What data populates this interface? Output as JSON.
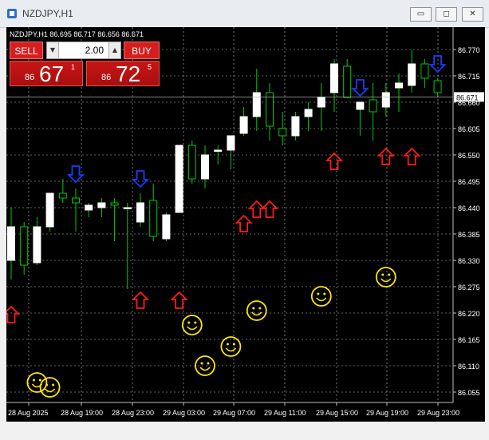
{
  "window": {
    "title": "NZDJPY,H1",
    "buttons": {
      "minimize": "▭",
      "restore": "◻",
      "close": "✕"
    }
  },
  "chart": {
    "symbol_line": "NZDJPY,H1 86.695 86.717 86.656 86.671",
    "current_price": "86.671",
    "price_labels": [
      "86.770",
      "86.715",
      "86.660",
      "86.605",
      "86.550",
      "86.495",
      "86.440",
      "86.385",
      "86.330",
      "86.275",
      "86.220",
      "86.165",
      "86.110",
      "86.055"
    ],
    "time_labels": [
      "28 Aug 2025",
      "28 Aug 19:00",
      "28 Aug 23:00",
      "29 Aug 03:00",
      "29 Aug 07:00",
      "29 Aug 11:00",
      "29 Aug 15:00",
      "29 Aug 19:00",
      "29 Aug 23:00"
    ],
    "colors": {
      "background": "#000000",
      "grid": "#c0c0c0",
      "wick": "#00cc00",
      "bull_body": "#ffffff",
      "sell_arrow": "#1a3cff",
      "buy_arrow": "#ff1a1a",
      "smiley": "#ffe600"
    },
    "candles": [
      {
        "o": 86.33,
        "h": 86.44,
        "l": 86.29,
        "c": 86.4
      },
      {
        "o": 86.4,
        "h": 86.41,
        "l": 86.3,
        "c": 86.32
      },
      {
        "o": 86.325,
        "h": 86.42,
        "l": 86.32,
        "c": 86.4
      },
      {
        "o": 86.4,
        "h": 86.47,
        "l": 86.39,
        "c": 86.47
      },
      {
        "o": 86.47,
        "h": 86.5,
        "l": 86.45,
        "c": 86.46
      },
      {
        "o": 86.46,
        "h": 86.48,
        "l": 86.39,
        "c": 86.45
      },
      {
        "o": 86.435,
        "h": 86.45,
        "l": 86.42,
        "c": 86.445
      },
      {
        "o": 86.44,
        "h": 86.46,
        "l": 86.42,
        "c": 86.45
      },
      {
        "o": 86.45,
        "h": 86.46,
        "l": 86.37,
        "c": 86.445
      },
      {
        "o": 86.44,
        "h": 86.45,
        "l": 86.27,
        "c": 86.44
      },
      {
        "o": 86.41,
        "h": 86.47,
        "l": 86.4,
        "c": 86.45
      },
      {
        "o": 86.455,
        "h": 86.49,
        "l": 86.37,
        "c": 86.38
      },
      {
        "o": 86.375,
        "h": 86.43,
        "l": 86.37,
        "c": 86.425
      },
      {
        "o": 86.43,
        "h": 86.57,
        "l": 86.43,
        "c": 86.57
      },
      {
        "o": 86.57,
        "h": 86.58,
        "l": 86.49,
        "c": 86.5
      },
      {
        "o": 86.5,
        "h": 86.57,
        "l": 86.48,
        "c": 86.55
      },
      {
        "o": 86.56,
        "h": 86.57,
        "l": 86.53,
        "c": 86.56
      },
      {
        "o": 86.56,
        "h": 86.59,
        "l": 86.52,
        "c": 86.59
      },
      {
        "o": 86.595,
        "h": 86.65,
        "l": 86.59,
        "c": 86.63
      },
      {
        "o": 86.63,
        "h": 86.73,
        "l": 86.6,
        "c": 86.68
      },
      {
        "o": 86.68,
        "h": 86.7,
        "l": 86.58,
        "c": 86.61
      },
      {
        "o": 86.605,
        "h": 86.64,
        "l": 86.57,
        "c": 86.59
      },
      {
        "o": 86.59,
        "h": 86.64,
        "l": 86.58,
        "c": 86.63
      },
      {
        "o": 86.63,
        "h": 86.66,
        "l": 86.6,
        "c": 86.645
      },
      {
        "o": 86.65,
        "h": 86.7,
        "l": 86.6,
        "c": 86.67
      },
      {
        "o": 86.68,
        "h": 86.75,
        "l": 86.64,
        "c": 86.74
      },
      {
        "o": 86.735,
        "h": 86.75,
        "l": 86.67,
        "c": 86.67
      },
      {
        "o": 86.645,
        "h": 86.66,
        "l": 86.59,
        "c": 86.66
      },
      {
        "o": 86.665,
        "h": 86.7,
        "l": 86.58,
        "c": 86.64
      },
      {
        "o": 86.65,
        "h": 86.7,
        "l": 86.63,
        "c": 86.68
      },
      {
        "o": 86.69,
        "h": 86.72,
        "l": 86.64,
        "c": 86.7
      },
      {
        "o": 86.695,
        "h": 86.77,
        "l": 86.68,
        "c": 86.74
      },
      {
        "o": 86.74,
        "h": 86.75,
        "l": 86.69,
        "c": 86.71
      },
      {
        "o": 86.705,
        "h": 86.71,
        "l": 86.67,
        "c": 86.68
      }
    ],
    "sell_arrows": [
      5,
      10,
      27,
      33
    ],
    "buy_arrows": [
      {
        "i": 0,
        "p": 86.2
      },
      {
        "i": 10,
        "p": 86.23
      },
      {
        "i": 13,
        "p": 86.23
      },
      {
        "i": 18,
        "p": 86.39
      },
      {
        "i": 19,
        "p": 86.42
      },
      {
        "i": 20,
        "p": 86.42
      },
      {
        "i": 25,
        "p": 86.52
      },
      {
        "i": 29,
        "p": 86.53
      },
      {
        "i": 31,
        "p": 86.53
      }
    ],
    "smileys": [
      {
        "i": 2,
        "p": 86.075
      },
      {
        "i": 3,
        "p": 86.065
      },
      {
        "i": 14,
        "p": 86.195
      },
      {
        "i": 15,
        "p": 86.11
      },
      {
        "i": 17,
        "p": 86.15
      },
      {
        "i": 19,
        "p": 86.225
      },
      {
        "i": 24,
        "p": 86.255
      },
      {
        "i": 29,
        "p": 86.295
      }
    ]
  },
  "trade_panel": {
    "sell_label": "SELL",
    "buy_label": "BUY",
    "lot_value": "2.00",
    "down_arrow": "▼",
    "up_arrow": "▲",
    "sell_price": {
      "prefix": "86",
      "big": "67",
      "sup": "1"
    },
    "buy_price": {
      "prefix": "86",
      "big": "72",
      "sup": "5"
    }
  }
}
